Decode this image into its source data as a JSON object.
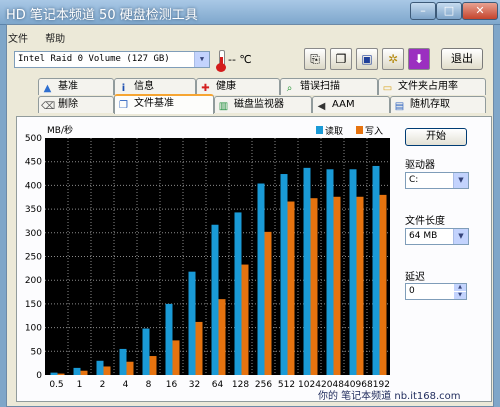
{
  "window": {
    "title": "HD 笔记本频道 50 硬盘检测工具",
    "minimize_glyph": "–",
    "maximize_glyph": "□",
    "close_glyph": "✕"
  },
  "menu": {
    "items": [
      "文件",
      "帮助"
    ]
  },
  "toolbar": {
    "drive": "Intel   Raid 0 Volume (127 GB)",
    "temperature": "-- ℃",
    "exit_label": "退出",
    "buttons": [
      {
        "icon": "copy-icon",
        "glyph": "⎘"
      },
      {
        "icon": "copy-report-icon",
        "glyph": "❐"
      },
      {
        "icon": "save-icon",
        "glyph": "▣"
      },
      {
        "icon": "options-icon",
        "glyph": "✲"
      },
      {
        "icon": "download-icon",
        "glyph": "⬇"
      }
    ]
  },
  "tabs": {
    "row1": [
      {
        "label": "基准",
        "icon": "benchmark-icon",
        "glyph": "▲",
        "color": "#2f6fd0"
      },
      {
        "label": "信息",
        "icon": "info-icon",
        "glyph": "i",
        "color": "#1d4fb0"
      },
      {
        "label": "健康",
        "icon": "health-icon",
        "glyph": "✚",
        "color": "#d42020"
      },
      {
        "label": "错误扫描",
        "icon": "error-scan-icon",
        "glyph": "⌕",
        "color": "#1c8f2e"
      },
      {
        "label": "文件夹占用率",
        "icon": "folder-usage-icon",
        "glyph": "▭",
        "color": "#d9a520"
      }
    ],
    "row2": [
      {
        "label": "删除",
        "icon": "erase-icon",
        "glyph": "⌫",
        "color": "#555555"
      },
      {
        "label": "文件基准",
        "icon": "file-benchmark-icon",
        "glyph": "❐",
        "color": "#2b62c0",
        "active": true
      },
      {
        "label": "磁盘监视器",
        "icon": "disk-monitor-icon",
        "glyph": "▥",
        "color": "#1b8c3a"
      },
      {
        "label": "AAM",
        "icon": "aam-icon",
        "glyph": "◀",
        "color": "#333333"
      },
      {
        "label": "随机存取",
        "icon": "random-access-icon",
        "glyph": "▤",
        "color": "#2b62c0"
      }
    ]
  },
  "side": {
    "start_label": "开始",
    "drive_label": "驱动器",
    "drive_value": "C:",
    "length_label": "文件长度",
    "length_value": "64 MB",
    "delay_label": "延迟",
    "delay_value": "0"
  },
  "watermark": "你的 笔记本频道 nb.it168.com",
  "chart_data": {
    "type": "bar",
    "ylabel": "MB/秒",
    "ylim": [
      0,
      500
    ],
    "yticks": [
      0,
      50,
      100,
      150,
      200,
      250,
      300,
      350,
      400,
      450,
      500
    ],
    "grid": true,
    "legend_position": "top-right",
    "categories": [
      "0.5",
      "1",
      "2",
      "4",
      "8",
      "16",
      "32",
      "64",
      "128",
      "256",
      "512",
      "1024",
      "2048",
      "4096",
      "8192"
    ],
    "series": [
      {
        "name": "读取",
        "color": "#1a9ad6",
        "values": [
          5,
          15,
          30,
          55,
          98,
          150,
          218,
          317,
          343,
          404,
          424,
          437,
          434,
          434,
          441
        ]
      },
      {
        "name": "写入",
        "color": "#e6730f",
        "values": [
          3,
          9,
          18,
          28,
          40,
          73,
          112,
          160,
          233,
          302,
          366,
          373,
          376,
          376,
          380
        ]
      }
    ]
  }
}
